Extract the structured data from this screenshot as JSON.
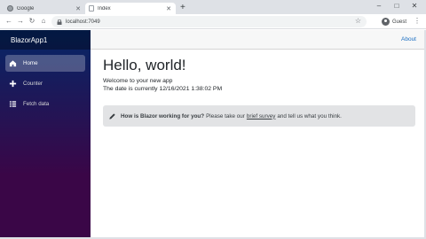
{
  "browser": {
    "tabs": [
      {
        "title": "Google",
        "active": false
      },
      {
        "title": "Index",
        "active": true
      }
    ],
    "new_tab_label": "+",
    "window_controls": [
      "–",
      "□",
      "✕"
    ],
    "url": "localhost:7049",
    "profile_label": "Guest",
    "nav_icons": [
      "back-icon",
      "forward-icon",
      "reload-icon",
      "home-icon"
    ]
  },
  "sidebar": {
    "brand": "BlazorApp1",
    "items": [
      {
        "label": "Home",
        "icon": "home-icon",
        "active": true
      },
      {
        "label": "Counter",
        "icon": "plus-icon",
        "active": false
      },
      {
        "label": "Fetch data",
        "icon": "list-icon",
        "active": false
      }
    ]
  },
  "topbar": {
    "about_label": "About"
  },
  "main": {
    "heading": "Hello, world!",
    "welcome": "Welcome to your new app",
    "date_text": "The date is currently 12/16/2021 1:38:02 PM",
    "survey": {
      "prompt": "How is Blazor working for you?",
      "before_link": "Please take our",
      "link": "brief survey",
      "after_link": "and tell us what you think."
    }
  },
  "colors": {
    "sidebar_top": "#052767",
    "sidebar_bottom": "#3a0647",
    "link": "#1b6ec2",
    "alert_bg": "#e2e3e5"
  }
}
